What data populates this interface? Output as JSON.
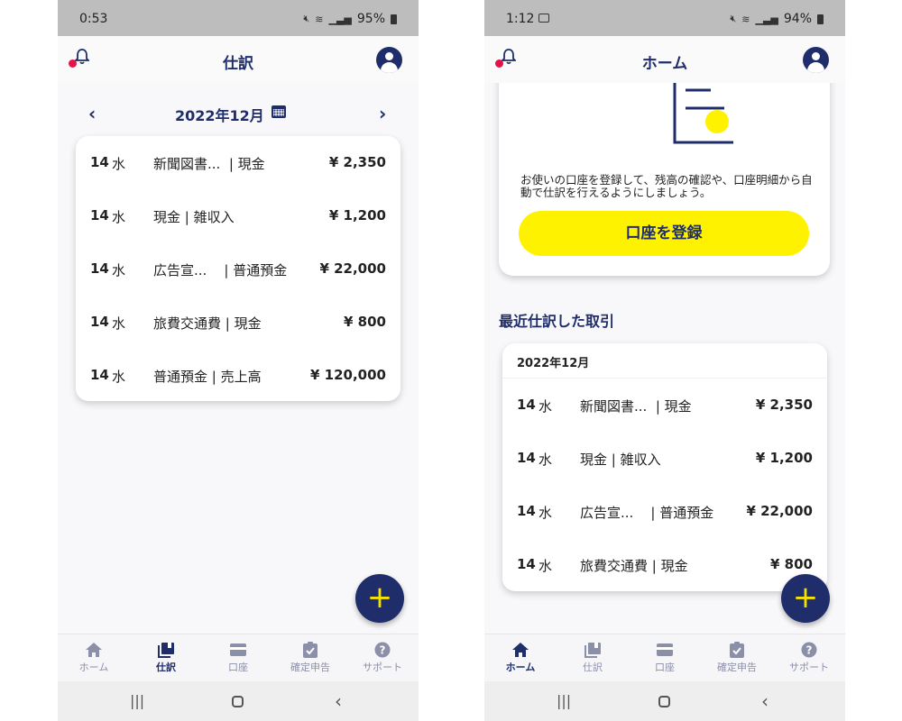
{
  "phone1": {
    "status": {
      "time": "0:53",
      "battery": "95%"
    },
    "header_title": "仕訳",
    "month": "2022年12月",
    "prev_arrow": "‹",
    "next_arrow": "›",
    "rows": [
      {
        "day": "14",
        "weekday": "水",
        "desc": "新聞図書...  | 現金",
        "amount": "¥ 2,350"
      },
      {
        "day": "14",
        "weekday": "水",
        "desc": "現金 | 雑収入",
        "amount": "¥ 1,200"
      },
      {
        "day": "14",
        "weekday": "水",
        "desc": "広告宣...    | 普通預金",
        "amount": "¥ 22,000"
      },
      {
        "day": "14",
        "weekday": "水",
        "desc": "旅費交通費 | 現金",
        "amount": "¥ 800"
      },
      {
        "day": "14",
        "weekday": "水",
        "desc": "普通預金 | 売上高",
        "amount": "¥ 120,000"
      }
    ],
    "fab_label": "+",
    "nav": [
      {
        "label": "ホーム",
        "icon": "home-icon"
      },
      {
        "label": "仕訳",
        "icon": "journal-icon",
        "active": true
      },
      {
        "label": "口座",
        "icon": "card-icon"
      },
      {
        "label": "確定申告",
        "icon": "clipboard-check-icon"
      },
      {
        "label": "サポート",
        "icon": "help-icon"
      }
    ]
  },
  "phone2": {
    "status": {
      "time": "1:12",
      "battery": "94%"
    },
    "header_title": "ホーム",
    "account_message": "お使いの口座を登録して、残高の確認や、口座明細から自動で仕訳を行えるようにしましょう。",
    "register_button": "口座を登録",
    "recent_title": "最近仕訳した取引",
    "recent_month": "2022年12月",
    "rows": [
      {
        "day": "14",
        "weekday": "水",
        "desc": "新聞図書...  | 現金",
        "amount": "¥ 2,350"
      },
      {
        "day": "14",
        "weekday": "水",
        "desc": "現金 | 雑収入",
        "amount": "¥ 1,200"
      },
      {
        "day": "14",
        "weekday": "水",
        "desc": "広告宣...    | 普通預金",
        "amount": "¥ 22,000"
      },
      {
        "day": "14",
        "weekday": "水",
        "desc": "旅費交通費 | 現金",
        "amount": "¥ 800"
      }
    ],
    "fab_label": "+",
    "nav": [
      {
        "label": "ホーム",
        "icon": "home-icon",
        "active": true
      },
      {
        "label": "仕訳",
        "icon": "journal-icon"
      },
      {
        "label": "口座",
        "icon": "card-icon"
      },
      {
        "label": "確定申告",
        "icon": "clipboard-check-icon"
      },
      {
        "label": "サポート",
        "icon": "help-icon"
      }
    ]
  },
  "system_nav": {
    "recents": "|||",
    "back": "‹"
  },
  "colors": {
    "navy": "#1f2d6b",
    "yellow": "#fff200",
    "alert": "#e3124a"
  }
}
